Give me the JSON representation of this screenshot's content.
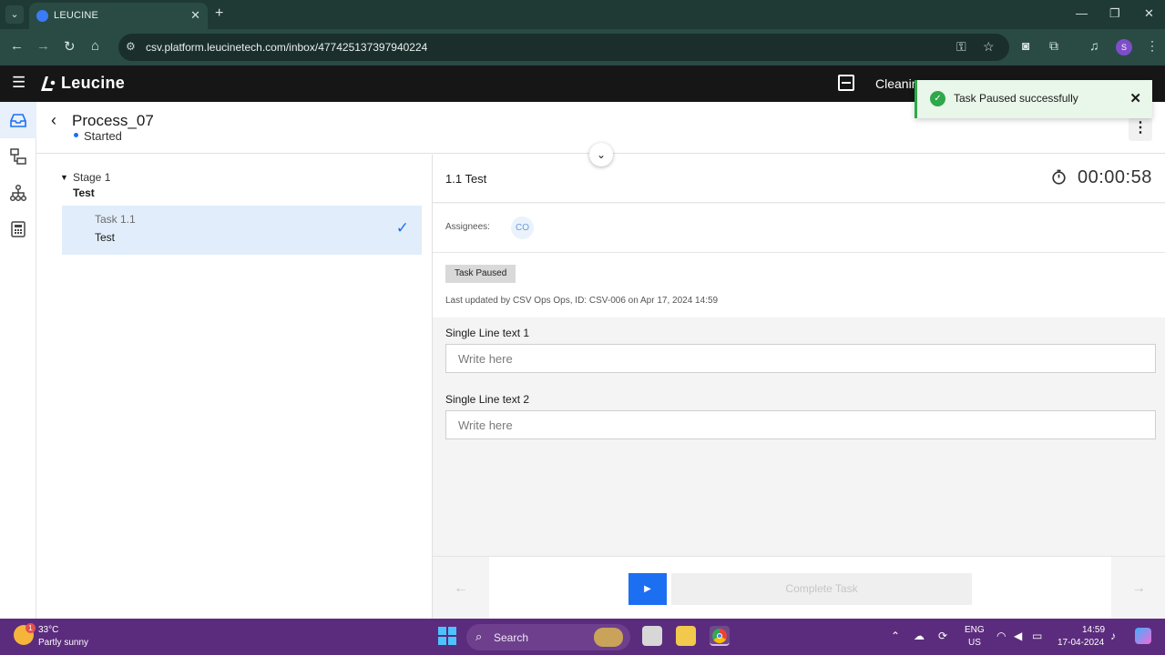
{
  "browser": {
    "tab_title": "LEUCINE",
    "url": "csv.platform.leucinetech.com/inbox/477425137397940224",
    "profile_initial": "S"
  },
  "app": {
    "brand": "Leucine",
    "facility_label": "Cleanin"
  },
  "process": {
    "title": "Process_07",
    "status": "Started"
  },
  "stage": {
    "label": "Stage 1",
    "name": "Test",
    "task": {
      "label": "Task 1.1",
      "name": "Test"
    }
  },
  "task": {
    "title": "1.1 Test",
    "timer": "00:00:58",
    "assignees_label": "Assignees:",
    "assignee_initials": "CO",
    "status_badge": "Task Paused",
    "last_updated": "Last updated by CSV Ops Ops, ID: CSV-006 on Apr 17, 2024 14:59",
    "fields": [
      {
        "label": "Single Line text 1",
        "placeholder": "Write here"
      },
      {
        "label": "Single Line text 2",
        "placeholder": "Write here"
      }
    ],
    "complete_label": "Complete Task"
  },
  "toast": {
    "message": "Task Paused successfully"
  },
  "taskbar": {
    "temperature": "33°C",
    "weather": "Partly sunny",
    "weather_badge": "1",
    "search_label": "Search",
    "lang_line1": "ENG",
    "lang_line2": "US",
    "time": "14:59",
    "date": "17-04-2024"
  },
  "colors": {
    "accent": "#1d6ff2",
    "toast_success": "#2ea84a",
    "app_header": "#161616",
    "browser_frame": "#294b44",
    "taskbar": "#5b2c7d"
  }
}
